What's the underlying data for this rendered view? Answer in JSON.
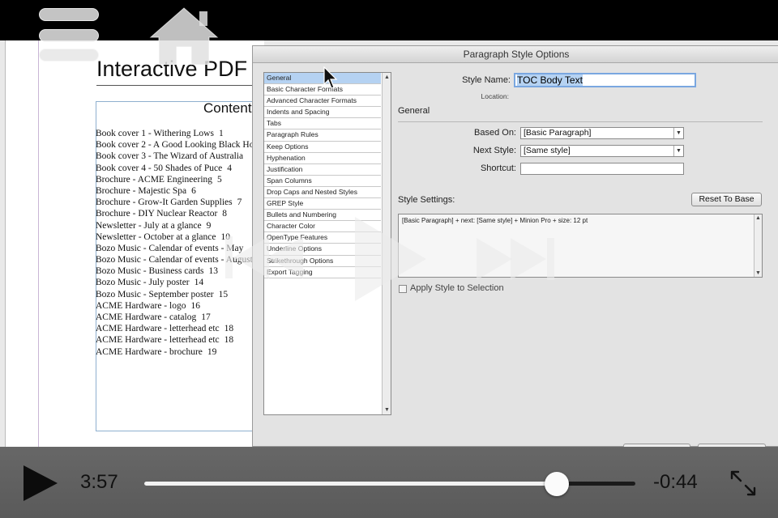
{
  "document": {
    "title": "Interactive PDF",
    "contents_heading": "Content",
    "toc": [
      {
        "text": "Book cover 1 - Withering Lows",
        "page": "1"
      },
      {
        "text": "Book cover 2 - A Good Looking Black Ho",
        "page": ""
      },
      {
        "text": "Book cover 3 - The Wizard of Australia",
        "page": ""
      },
      {
        "text": "Book cover 4 - 50 Shades of Puce",
        "page": "4"
      },
      {
        "text": "Brochure - ACME Engineering",
        "page": "5"
      },
      {
        "text": "Brochure - Majestic Spa",
        "page": "6"
      },
      {
        "text": "Brochure - Grow-It Garden Supplies",
        "page": "7"
      },
      {
        "text": "Brochure - DIY Nuclear Reactor",
        "page": "8"
      },
      {
        "text": "Newsletter - July at a glance",
        "page": "9"
      },
      {
        "text": "Newsletter - October at a glance",
        "page": "10"
      },
      {
        "text": "Bozo Music - Calendar of events - May",
        "page": ""
      },
      {
        "text": "Bozo Music - Calendar of events - August",
        "page": ""
      },
      {
        "text": "Bozo Music - Business cards",
        "page": "13"
      },
      {
        "text": "Bozo Music - July poster",
        "page": "14"
      },
      {
        "text": "Bozo Music - September poster",
        "page": "15"
      },
      {
        "text": "ACME Hardware - logo",
        "page": "16"
      },
      {
        "text": "ACME Hardware - catalog",
        "page": "17"
      },
      {
        "text": "ACME Hardware - letterhead etc",
        "page": "18"
      },
      {
        "text": "ACME Hardware - letterhead etc",
        "page": "18"
      },
      {
        "text": "ACME Hardware - brochure",
        "page": "19"
      }
    ]
  },
  "dialog": {
    "title": "Paragraph Style Options",
    "categories": [
      {
        "label": "General",
        "selected": true
      },
      {
        "label": "Basic Character Formats",
        "selected": false
      },
      {
        "label": "Advanced Character Formats",
        "selected": false
      },
      {
        "label": "Indents and Spacing",
        "selected": false
      },
      {
        "label": "Tabs",
        "selected": false
      },
      {
        "label": "Paragraph Rules",
        "selected": false
      },
      {
        "label": "Keep Options",
        "selected": false
      },
      {
        "label": "Hyphenation",
        "selected": false
      },
      {
        "label": "Justification",
        "selected": false
      },
      {
        "label": "Span Columns",
        "selected": false
      },
      {
        "label": "Drop Caps and Nested Styles",
        "selected": false
      },
      {
        "label": "GREP Style",
        "selected": false
      },
      {
        "label": "Bullets and Numbering",
        "selected": false
      },
      {
        "label": "Character Color",
        "selected": false
      },
      {
        "label": "OpenType Features",
        "selected": false
      },
      {
        "label": "Underline Options",
        "selected": false
      },
      {
        "label": "Strikethrough Options",
        "selected": false
      },
      {
        "label": "Export Tagging",
        "selected": false
      }
    ],
    "style_name_label": "Style Name:",
    "style_name_value": "TOC Body Text",
    "location_label": "Location:",
    "section_heading": "General",
    "based_on_label": "Based On:",
    "based_on_value": "[Basic Paragraph]",
    "next_style_label": "Next Style:",
    "next_style_value": "[Same style]",
    "shortcut_label": "Shortcut:",
    "shortcut_value": "",
    "style_settings_label": "Style Settings:",
    "reset_button": "Reset To Base",
    "style_settings_text": "[Basic Paragraph] + next: [Same style] + Minion Pro + size: 12 pt",
    "apply_checkbox_label": "Apply Style to Selection",
    "apply_checked": false
  },
  "player": {
    "elapsed": "3:57",
    "remaining": "-0:44",
    "progress": 0.84,
    "icons": [
      "menu-icon",
      "home-icon",
      "previous-icon",
      "play-icon",
      "next-icon",
      "fullscreen-icon"
    ]
  }
}
